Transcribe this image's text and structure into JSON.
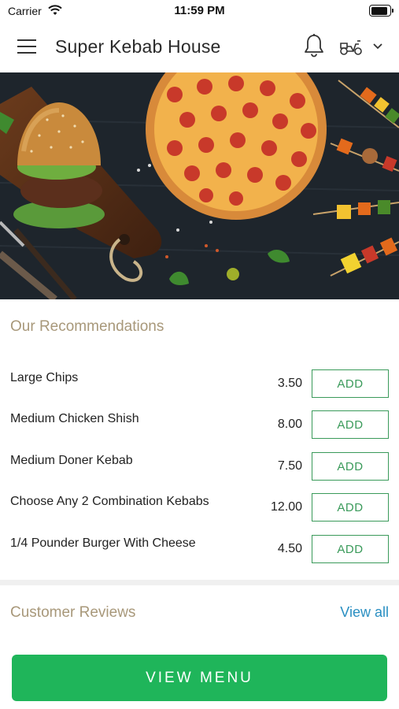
{
  "status": {
    "carrier": "Carrier",
    "time": "11:59 PM"
  },
  "header": {
    "title": "Super Kebab House"
  },
  "recommendations": {
    "title": "Our Recommendations",
    "items": [
      {
        "name": "Large Chips",
        "price": "3.50",
        "button": "ADD"
      },
      {
        "name": "Medium Chicken Shish",
        "price": "8.00",
        "button": "ADD"
      },
      {
        "name": "Medium Doner Kebab",
        "price": "7.50",
        "button": "ADD"
      },
      {
        "name": "Choose Any 2 Combination Kebabs",
        "price": "12.00",
        "button": "ADD"
      },
      {
        "name": "1/4 Pounder Burger With Cheese",
        "price": "4.50",
        "button": "ADD"
      }
    ]
  },
  "reviews": {
    "title": "Customer Reviews",
    "view_all": "View all"
  },
  "footer": {
    "view_menu": "VIEW MENU"
  },
  "icons": [
    "menu-icon",
    "bell-icon",
    "delivery-scooter-icon",
    "chevron-down-icon",
    "wifi-icon",
    "battery-icon"
  ],
  "colors": {
    "accent_green": "#1fb55a",
    "add_border": "#3a9a5a",
    "section_title": "#a8987a",
    "link_blue": "#2a8fc2"
  }
}
